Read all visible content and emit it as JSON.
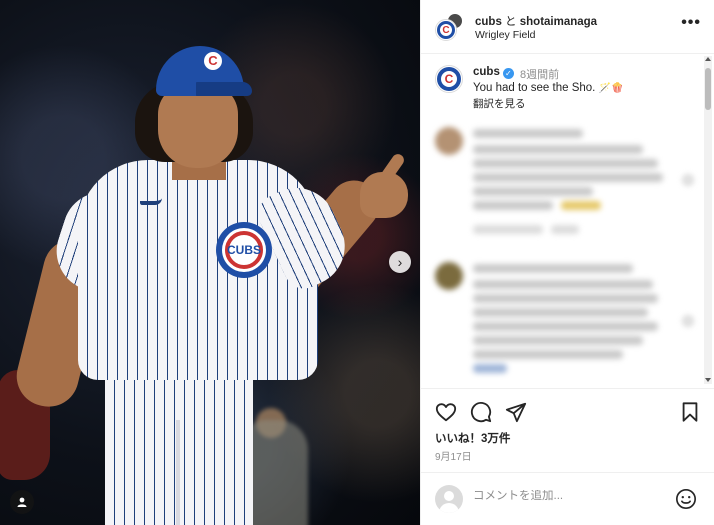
{
  "header": {
    "account_primary": "cubs",
    "connector": "と",
    "account_secondary": "shotaimanaga",
    "location": "Wrigley Field",
    "more": "•••"
  },
  "caption": {
    "username": "cubs",
    "time_ago": "8週間前",
    "text": "You had to see the Sho.",
    "emoji": "🪄🍿",
    "translate": "翻訳を見る"
  },
  "jersey": {
    "badge_text": "CUBS",
    "cap_logo": "C"
  },
  "media": {
    "next": "›"
  },
  "stats": {
    "likes": "いいね！3万件",
    "date": "9月17日"
  },
  "composer": {
    "placeholder": "コメントを追加..."
  },
  "colors": {
    "cubs_blue": "#1f4ea6",
    "cubs_red": "#cc3433",
    "verified": "#3897f0"
  },
  "icons": [
    "heart-icon",
    "comment-icon",
    "share-icon",
    "bookmark-icon",
    "emoji-icon",
    "user-tag-icon",
    "chevron-right-icon",
    "more-icon"
  ]
}
